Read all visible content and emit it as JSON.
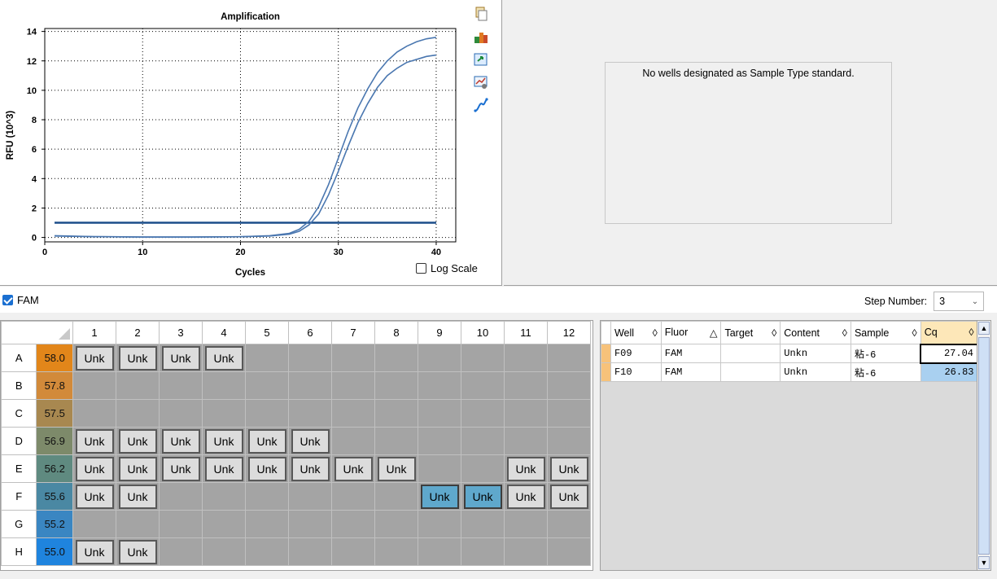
{
  "chart_data": {
    "type": "line",
    "title": "Amplification",
    "xlabel": "Cycles",
    "ylabel": "RFU (10^3)",
    "xlim": [
      0,
      42
    ],
    "ylim": [
      -0.3,
      14.2
    ],
    "xticks": [
      0,
      10,
      20,
      30,
      40
    ],
    "yticks": [
      0,
      2,
      4,
      6,
      8,
      10,
      12,
      14
    ],
    "grid": true,
    "threshold": 1.0,
    "series": [
      {
        "x": [
          1,
          5,
          10,
          15,
          20,
          23,
          25,
          26,
          27,
          28,
          29,
          30,
          31,
          32,
          33,
          34,
          35,
          36,
          37,
          38,
          39,
          40
        ],
        "y": [
          0.1,
          0.05,
          0.03,
          0.03,
          0.05,
          0.12,
          0.28,
          0.55,
          1.1,
          2.1,
          3.6,
          5.4,
          7.2,
          8.8,
          10.1,
          11.2,
          12.0,
          12.6,
          13.0,
          13.3,
          13.5,
          13.6
        ]
      },
      {
        "x": [
          1,
          5,
          10,
          15,
          20,
          23,
          25,
          26,
          27,
          28,
          29,
          30,
          31,
          32,
          33,
          34,
          35,
          36,
          37,
          38,
          39,
          40
        ],
        "y": [
          0.12,
          0.06,
          0.03,
          0.03,
          0.05,
          0.1,
          0.22,
          0.42,
          0.85,
          1.6,
          2.9,
          4.5,
          6.2,
          7.8,
          9.1,
          10.2,
          11.0,
          11.5,
          11.9,
          12.1,
          12.3,
          12.4
        ]
      }
    ]
  },
  "chart_ui": {
    "log_scale_label": "Log Scale",
    "log_scale_checked": false
  },
  "toolbar": [
    "copy-icon",
    "export-icon",
    "refresh-icon",
    "chart-settings-icon",
    "curve-icon"
  ],
  "standard_curve": {
    "message": "No wells designated as Sample Type standard."
  },
  "fluor_filter": {
    "label": "FAM",
    "checked": true
  },
  "step_number": {
    "label": "Step Number:",
    "value": "3"
  },
  "plate": {
    "columns": [
      "1",
      "2",
      "3",
      "4",
      "5",
      "6",
      "7",
      "8",
      "9",
      "10",
      "11",
      "12"
    ],
    "rows": [
      {
        "id": "A",
        "temp": "58.0",
        "color": "#e2861a",
        "wells": [
          "Unk",
          "Unk",
          "Unk",
          "Unk",
          "",
          "",
          "",
          "",
          "",
          "",
          "",
          ""
        ]
      },
      {
        "id": "B",
        "temp": "57.8",
        "color": "#d28a3a",
        "wells": [
          "",
          "",
          "",
          "",
          "",
          "",
          "",
          "",
          "",
          "",
          "",
          ""
        ]
      },
      {
        "id": "C",
        "temp": "57.5",
        "color": "#a88850",
        "wells": [
          "",
          "",
          "",
          "",
          "",
          "",
          "",
          "",
          "",
          "",
          "",
          ""
        ]
      },
      {
        "id": "D",
        "temp": "56.9",
        "color": "#7d8a6a",
        "wells": [
          "Unk",
          "Unk",
          "Unk",
          "Unk",
          "Unk",
          "Unk",
          "",
          "",
          "",
          "",
          "",
          ""
        ]
      },
      {
        "id": "E",
        "temp": "56.2",
        "color": "#5f8a80",
        "wells": [
          "Unk",
          "Unk",
          "Unk",
          "Unk",
          "Unk",
          "Unk",
          "Unk",
          "Unk",
          "",
          "",
          "Unk",
          "Unk"
        ]
      },
      {
        "id": "F",
        "temp": "55.6",
        "color": "#4a88a3",
        "wells": [
          "Unk",
          "Unk",
          "",
          "",
          "",
          "",
          "",
          "",
          "Unk*",
          "Unk*",
          "Unk",
          "Unk"
        ]
      },
      {
        "id": "G",
        "temp": "55.2",
        "color": "#3a86c2",
        "wells": [
          "",
          "",
          "",
          "",
          "",
          "",
          "",
          "",
          "",
          "",
          "",
          ""
        ]
      },
      {
        "id": "H",
        "temp": "55.0",
        "color": "#1f84de",
        "wells": [
          "Unk",
          "Unk",
          "",
          "",
          "",
          "",
          "",
          "",
          "",
          "",
          "",
          ""
        ]
      }
    ]
  },
  "results": {
    "headers": [
      {
        "label": "Well",
        "sort": "◊"
      },
      {
        "label": "Fluor",
        "sort": "△"
      },
      {
        "label": "Target",
        "sort": "◊"
      },
      {
        "label": "Content",
        "sort": "◊"
      },
      {
        "label": "Sample",
        "sort": "◊"
      },
      {
        "label": "Cq",
        "sort": "◊"
      }
    ],
    "rows": [
      {
        "well": "F09",
        "fluor": "FAM",
        "target": "",
        "content": "Unkn",
        "sample": "粘-6",
        "cq": "27.04"
      },
      {
        "well": "F10",
        "fluor": "FAM",
        "target": "",
        "content": "Unkn",
        "sample": "粘-6",
        "cq": "26.83"
      }
    ]
  }
}
